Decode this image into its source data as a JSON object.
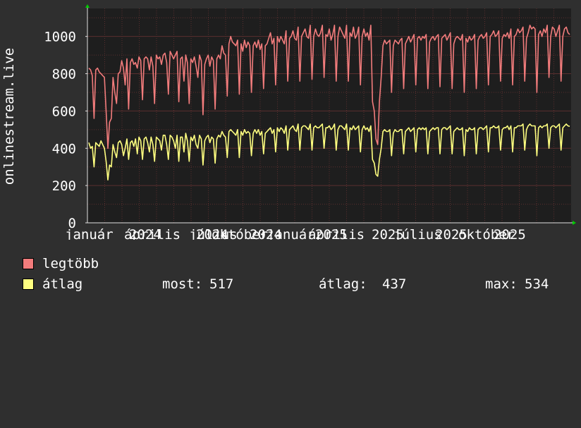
{
  "chart_data": {
    "type": "line",
    "ylabel": "onlinestream.live",
    "ylim": [
      0,
      1150
    ],
    "yticks": [
      0,
      200,
      400,
      600,
      800,
      1000
    ],
    "xtick_labels": [
      "január",
      "április",
      "2024",
      "július",
      "2024",
      "október",
      "2024",
      "január",
      "2025",
      "április",
      "2025",
      "július",
      "2025",
      "október",
      "2025"
    ],
    "series": [
      {
        "name": "legtöbb",
        "color": "#f27c7c",
        "values": [
          830,
          820,
          790,
          560,
          820,
          830,
          810,
          800,
          790,
          780,
          600,
          400,
          540,
          560,
          780,
          700,
          640,
          800,
          810,
          870,
          830,
          740,
          880,
          610,
          860,
          880,
          850,
          860,
          830,
          890,
          870,
          660,
          880,
          890,
          880,
          820,
          890,
          840,
          640,
          900,
          880,
          890,
          850,
          900,
          910,
          860,
          690,
          920,
          900,
          880,
          900,
          920,
          650,
          880,
          890,
          760,
          900,
          860,
          640,
          880,
          860,
          890,
          840,
          780,
          900,
          870,
          580,
          850,
          880,
          900,
          840,
          890,
          870,
          610,
          880,
          900,
          880,
          950,
          910,
          900,
          680,
          960,
          1000,
          970,
          960,
          950,
          980,
          690,
          960,
          920,
          980,
          940,
          970,
          950,
          700,
          950,
          970,
          940,
          980,
          930,
          960,
          720,
          950,
          960,
          990,
          1020,
          960,
          990,
          740,
          1000,
          970,
          1000,
          980,
          960,
          1030,
          760,
          990,
          1000,
          1030,
          990,
          980,
          1050,
          760,
          1000,
          1020,
          1040,
          1000,
          990,
          1060,
          770,
          1000,
          1040,
          1010,
          1000,
          1020,
          1060,
          780,
          1010,
          1000,
          1040,
          980,
          1010,
          1060,
          760,
          1000,
          1050,
          1030,
          1010,
          990,
          1060,
          760,
          1020,
          1000,
          1050,
          990,
          1010,
          1050,
          740,
          1000,
          1040,
          1000,
          1020,
          980,
          1060,
          650,
          600,
          450,
          420,
          650,
          780,
          950,
          980,
          960,
          970,
          980,
          700,
          950,
          980,
          970,
          960,
          980,
          990,
          720,
          960,
          980,
          1000,
          970,
          990,
          1010,
          740,
          990,
          1000,
          980,
          1000,
          990,
          1010,
          720,
          970,
          990,
          1000,
          980,
          1000,
          1010,
          730,
          990,
          1000,
          1010,
          980,
          1000,
          1020,
          720,
          960,
          990,
          1000,
          990,
          980,
          1010,
          700,
          990,
          970,
          1000,
          980,
          990,
          1010,
          720,
          980,
          1000,
          1010,
          990,
          1000,
          1020,
          740,
          1000,
          1010,
          1030,
          1000,
          1010,
          1030,
          760,
          990,
          1010,
          1000,
          1020,
          990,
          1040,
          740,
          1000,
          1010,
          1040,
          1020,
          1030,
          1050,
          760,
          990,
          1020,
          1060,
          1040,
          1050,
          1040,
          700,
          1010,
          1030,
          1000,
          1040,
          1020,
          1060,
          780,
          1000,
          1050,
          1040,
          1000,
          1030,
          1060,
          760,
          1000,
          1040,
          1050,
          1020,
          1010
        ]
      },
      {
        "name": "átlag",
        "color": "#ffff80",
        "values": [
          430,
          400,
          410,
          300,
          430,
          420,
          410,
          440,
          420,
          400,
          330,
          230,
          310,
          300,
          420,
          380,
          350,
          430,
          440,
          420,
          360,
          400,
          450,
          340,
          430,
          440,
          410,
          450,
          370,
          460,
          440,
          340,
          450,
          460,
          430,
          380,
          460,
          420,
          330,
          460,
          450,
          440,
          390,
          470,
          470,
          420,
          340,
          470,
          460,
          440,
          400,
          470,
          330,
          460,
          460,
          380,
          480,
          440,
          330,
          460,
          440,
          470,
          420,
          400,
          470,
          450,
          310,
          440,
          460,
          470,
          430,
          460,
          450,
          320,
          450,
          470,
          460,
          490,
          470,
          460,
          350,
          490,
          500,
          490,
          480,
          470,
          500,
          350,
          490,
          470,
          500,
          480,
          490,
          480,
          360,
          480,
          500,
          480,
          500,
          470,
          490,
          370,
          480,
          490,
          500,
          510,
          480,
          500,
          380,
          510,
          490,
          510,
          500,
          480,
          520,
          390,
          500,
          510,
          520,
          500,
          490,
          530,
          390,
          510,
          520,
          520,
          510,
          500,
          530,
          390,
          510,
          520,
          510,
          510,
          520,
          530,
          400,
          510,
          510,
          520,
          500,
          510,
          530,
          390,
          500,
          520,
          520,
          510,
          500,
          530,
          390,
          510,
          500,
          520,
          500,
          510,
          520,
          380,
          500,
          520,
          500,
          510,
          490,
          520,
          340,
          320,
          260,
          250,
          340,
          400,
          490,
          500,
          490,
          490,
          500,
          360,
          480,
          500,
          490,
          490,
          500,
          500,
          370,
          490,
          500,
          510,
          490,
          500,
          510,
          380,
          500,
          510,
          500,
          510,
          500,
          510,
          370,
          490,
          500,
          510,
          500,
          510,
          510,
          370,
          500,
          510,
          510,
          500,
          510,
          520,
          370,
          490,
          500,
          510,
          500,
          500,
          510,
          360,
          500,
          490,
          510,
          500,
          500,
          510,
          370,
          500,
          510,
          510,
          500,
          510,
          520,
          380,
          510,
          510,
          520,
          510,
          510,
          520,
          390,
          500,
          510,
          510,
          520,
          500,
          520,
          380,
          510,
          510,
          520,
          520,
          520,
          530,
          390,
          500,
          520,
          530,
          520,
          520,
          520,
          360,
          510,
          520,
          510,
          520,
          520,
          530,
          400,
          510,
          520,
          520,
          510,
          520,
          530,
          390,
          510,
          520,
          530,
          520,
          517
        ]
      }
    ],
    "legend": [
      {
        "name": "legtöbb",
        "color": "#f27c7c"
      },
      {
        "name": "átlag",
        "color": "#ffff80",
        "now_label": "most:",
        "now": 517,
        "avg_label": "átlag:",
        "avg": 437,
        "max_label": "max:",
        "max": 534
      }
    ],
    "grid": true,
    "colors": {
      "background": "#2f2f2f",
      "plot": "#1e1e1e",
      "grid": "#5a2f2f",
      "axis": "#e0e0e0",
      "arrow": "#00cc00"
    }
  }
}
